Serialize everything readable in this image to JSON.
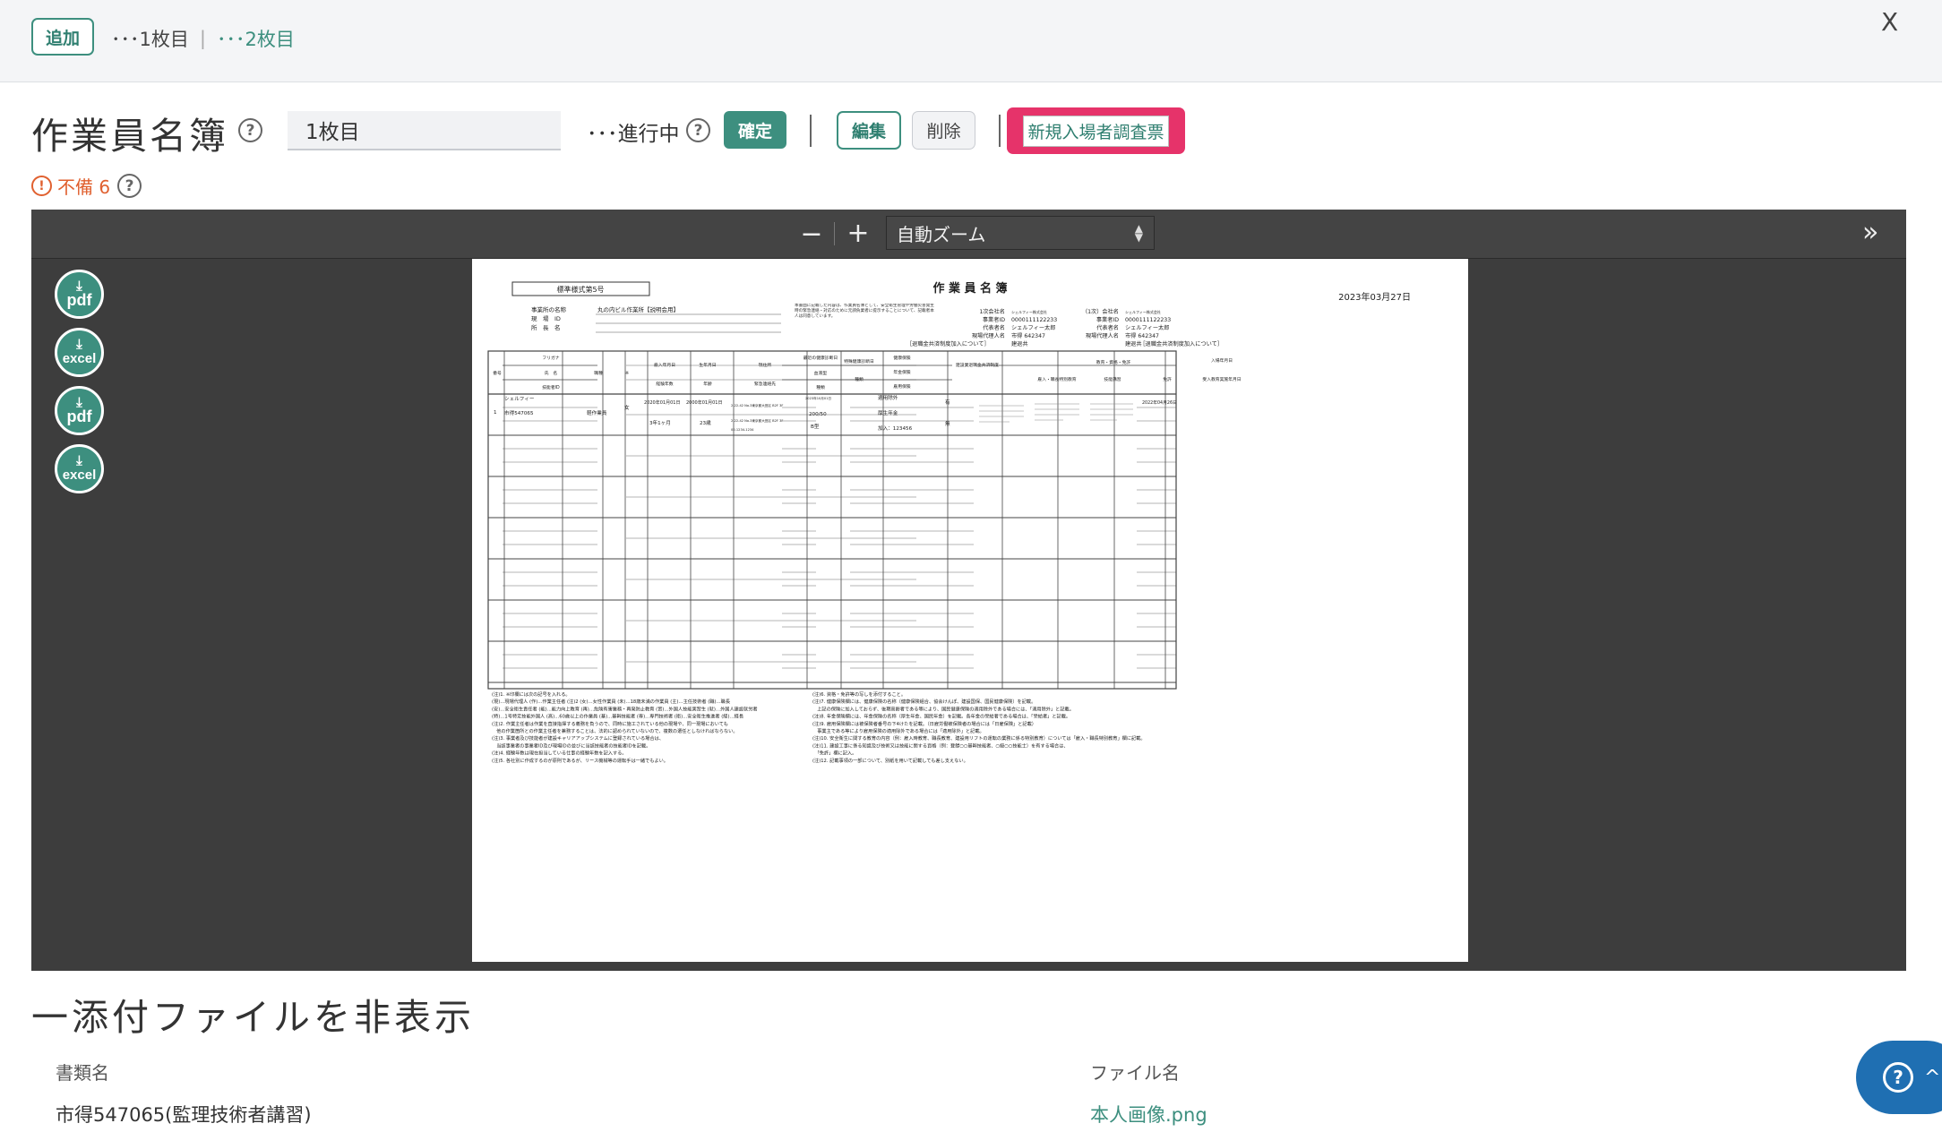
{
  "topbar": {
    "add_label": "追加",
    "sheet_tabs": [
      "･･･1枚目",
      "･･･2枚目"
    ],
    "separator": "|",
    "close_label": "X"
  },
  "header": {
    "title": "作業員名簿",
    "sheet_name_value": "1枚目",
    "status": "･･･進行中",
    "confirm_label": "確定",
    "edit_label": "編集",
    "delete_label": "削除",
    "new_entry_label": "新規入場者調査票"
  },
  "warning": {
    "label": "不備 6"
  },
  "viewer": {
    "zoom_out": "−",
    "zoom_in": "+",
    "zoom_value": "自動ズーム",
    "sidebar_toggle": "»",
    "downloads": [
      "pdf",
      "excel",
      "pdf",
      "excel"
    ],
    "doc": {
      "form_no": "標準様式第5号",
      "title": "作 業 員 名 簿",
      "date": "2023年03月27日",
      "site_label": "事業所の名称",
      "site_value": "丸の内ビル作業所【説明会用】",
      "field_labels": [
        "現　場　ID",
        "所　長　名"
      ],
      "notice": "本書面に記載した内容は、作業員名簿として、安全衛生管理や労働災害発生時の緊急連絡・対応のために元請負業者に提示することについて、記載者本人は同意しています。",
      "company_1": {
        "labels": [
          "1次会社名",
          "事業者ID",
          "代表者名",
          "現場代理人名"
        ],
        "values": [
          "シェルフィー株式会社",
          "0000111122233",
          "シェルフィー太郎",
          "市得 642347"
        ]
      },
      "company_2": {
        "labels": [
          "（1次）会社名",
          "事業者ID",
          "代表者名",
          "現場代理人名"
        ],
        "values": [
          "シェルフィー株式会社",
          "0000111122233",
          "シェルフィー太郎",
          "市得 642347"
        ]
      },
      "retirement_note": "［退職金共済制度加入について］",
      "retirement_value": "建退共",
      "headers": [
        "番号",
        "フリガナ",
        "氏　名",
        "技能者ID",
        "職種",
        "※",
        "雇入年月日",
        "生年月日",
        "現住所",
        "最近の健康診断日",
        "血液型",
        "特殊健康診断日",
        "健康保険",
        "年金保険",
        "雇用保険",
        "建設業退職金共済制度",
        "教育・資格・免許",
        "雇入・職長特別教育",
        "技能講習",
        "免許",
        "入場年月日",
        "受入教育実施年月日",
        "経験年数",
        "年齢",
        "緊急連絡先",
        "血圧",
        "種類"
      ],
      "row_1": {
        "no": "1",
        "kana": "シェルフィー",
        "name": "市得547065",
        "job": "軽作業員",
        "mark": "女",
        "hire_date": "2020年01月01日",
        "birth_date": "2000年01月01日",
        "experience": "3年1ヶ月",
        "age": "23歳",
        "address": "2-22-42 No.3東京都大田区 B2F 3F",
        "emergency": "2-22-42 No.3東京都大田区 B2F 3F",
        "phone": "00-1234-1234",
        "checkup_date": "2023年10月01日",
        "blood_pressure": "200/50",
        "blood_type": "B型",
        "health_ins": "適用除外",
        "pension": "厚生年金",
        "employment_ins": "加入：123456",
        "retire_1": "有",
        "retire_2": "無",
        "entry_date": "2022年04月26日"
      },
      "notes_left": [
        "(注)1. ※印欄には次の記号を入れる。",
        "(現)…現場代理人 (作)…作業主任者 (注)2 (女)…女性作業員 (未)…18歳未満の作業員 (主)…主任技術者 (職)…職長",
        "(安)…安全衛生責任者 (能)…能力向上教育 (再)…危険有害業務・再発防止教育 (習)…外国人技能実習生 (就)…外国人建設就労者",
        "(特)…1号特定技能外国人 (高)…60歳以上の作業員 (基)…基幹技能者 (専)…専門技術者 (衛)…安全衛生推進者 (経)…経長",
        "(注)2. 作業主任者は作業を直接指揮する義務を負うので、同時に施工されている他の現場や、同一現場においても",
        "　他の作業箇所との作業主任者を兼務することは、法的に認められていないので、複数の選任としなければならない。",
        "(注)3. 事業者及び技能者が建設キャリアアップシステムに登録されている場合は、",
        "　当該事業者の事業者ID及び現場IDの並びに当該技能者の技能者IDを記載。",
        "(注)4. 経験年数は現在担当している仕事の経験年数を記入する。",
        "(注)5. 各社別に作成するのが原則であるが、リース機械等の運転手は一緒でもよい。"
      ],
      "notes_right": [
        "(注)6. 資格・免許等の写しを添付すること。",
        "(注)7. 健康保険欄には、健康保険の名称（健康保険組合、協会けんぽ、建設国保、国民健康保険）を記載。",
        "　上記の保険に加入しておらず、後期高齢者である等により、国民健康保険の適用除外である場合には、「適用除外」と記載。",
        "(注)8. 年金保険欄には、年金保険の名称（厚生年金、国民年金）を記載。各年金の受給者である場合は、「受給者」と記載。",
        "(注)9. 雇用保険欄には被保険者番号の下4けたを記載。（日雇労働被保険者の場合には「日雇保険」と記載）",
        "　事業主である等により雇用保険の適用除外である場合には「適用除外」と記載。",
        "(注)10. 安全衛生に関する教育の内容（例：雇入時教育、職長教育、建設用リフトの運転の業務に係る特別教育）については「雇入・職長特別教育」欄に記載。",
        "(注)11. 建設工事に係る知識及び技術又は技能に関する資格（例：登録○○基幹技能者、○級○○技能士）を有する場合は、",
        "　「免許」欄に記入。",
        "(注)12. 記載事項の一部について、別紙を用いて記載しても差し支えない。"
      ]
    }
  },
  "attachments": {
    "toggle_label": "一添付ファイルを非表示",
    "col_doc": "書類名",
    "col_file": "ファイル名",
    "rows": [
      {
        "doc": "市得547065(監理技術者講習)",
        "file": "本人画像.png"
      }
    ]
  },
  "colors": {
    "accent": "#3d8f7f",
    "warning": "#e0602f",
    "highlight": "#e6336a",
    "help_fab": "#1f6fb2"
  }
}
